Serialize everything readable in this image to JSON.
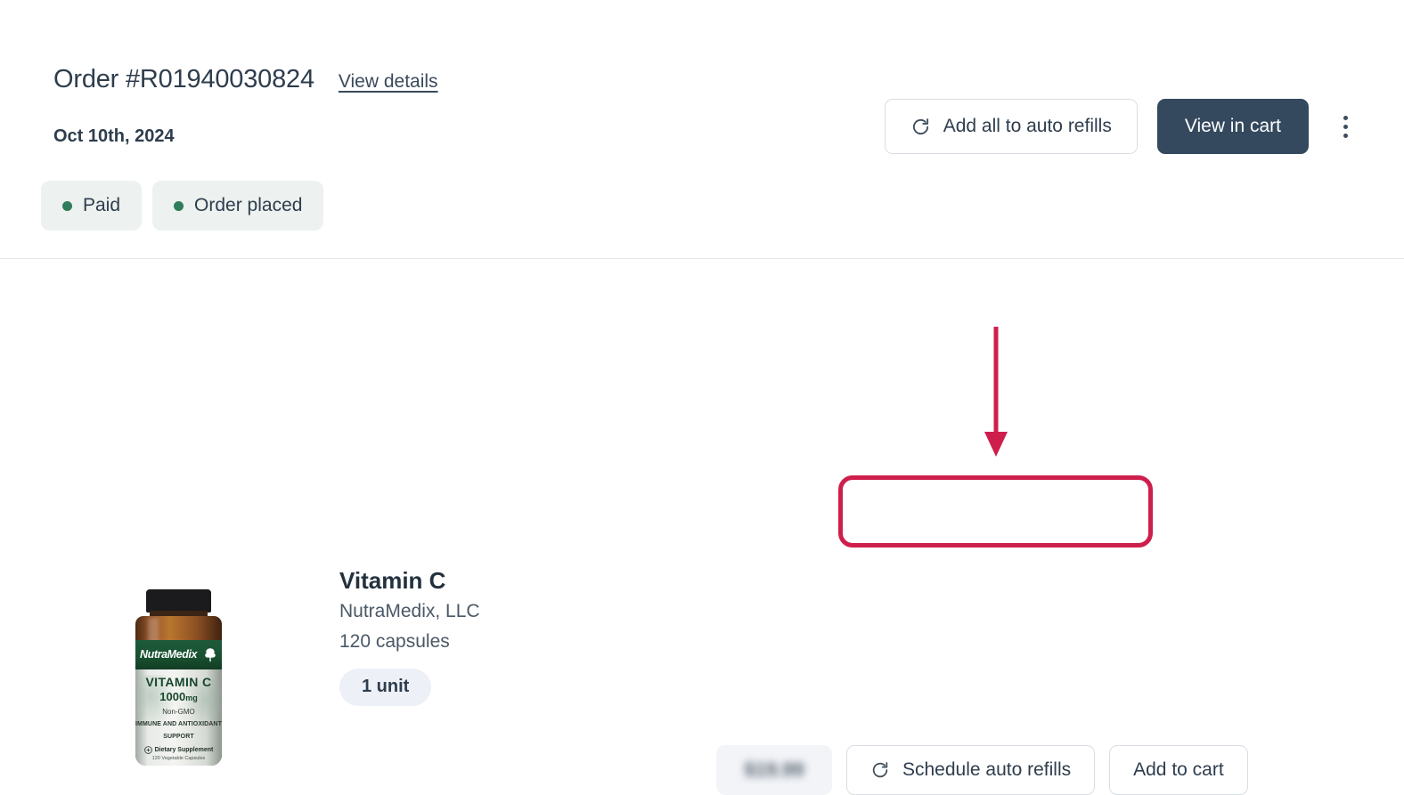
{
  "order": {
    "number": "Order #R01940030824",
    "view_details_label": "View details",
    "date": "Oct 10th, 2024",
    "badges": [
      {
        "label": "Paid",
        "dot_color": "#2E7D5B"
      },
      {
        "label": "Order placed",
        "dot_color": "#2E7D5B"
      }
    ],
    "actions": {
      "add_all_label": "Add all to auto refills",
      "add_all_icon": "refresh-icon",
      "view_cart_label": "View in cart",
      "more_icon": "kebab-menu-icon"
    }
  },
  "item": {
    "name": "Vitamin C",
    "brand": "NutraMedix, LLC",
    "size": "120 capsules",
    "quantity_label": "1 unit",
    "price": "$19.99",
    "price_hidden": true,
    "actions": {
      "schedule_label": "Schedule auto refills",
      "schedule_icon": "refresh-icon",
      "add_to_cart_label": "Add to cart"
    },
    "product_image": {
      "brand_text": "NutraMedix",
      "title": "VITAMIN C",
      "dose": "1000",
      "dose_unit": "mg",
      "non_gmo": "Non-GMO",
      "support_claim": "IMMUNE AND ANTIOXIDANT SUPPORT",
      "supplement_text": "Dietary Supplement",
      "count_text": "120 Vegetable Capsules"
    }
  },
  "annotations": {
    "highlight_color": "#CE1F4C",
    "arrow_color": "#CE1F4C",
    "target": "schedule-auto-refills-button"
  },
  "theme": {
    "primary_button": "#34495E",
    "text": "#2E3D4D",
    "badge_background": "#EDF1EF",
    "pill_background": "#EDF0F6",
    "border": "#D9DEE4"
  }
}
